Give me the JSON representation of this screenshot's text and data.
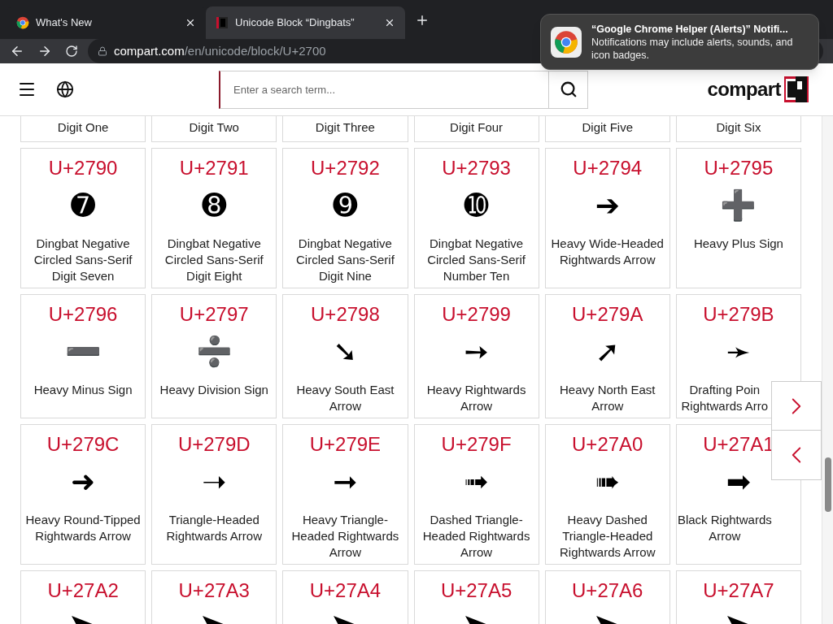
{
  "browser": {
    "tabs": [
      {
        "title": "What's New",
        "selected": false
      },
      {
        "title": "Unicode Block “Dingbats”",
        "selected": true
      }
    ],
    "url_host": "compart.com",
    "url_path": "/en/unicode/block/U+2700"
  },
  "notification": {
    "title": "“Google Chrome Helper (Alerts)” Notifi...",
    "body": "Notifications may include alerts, sounds, and icon badges."
  },
  "header": {
    "search_placeholder": "Enter a search term...",
    "logo": "compart"
  },
  "top_row": [
    {
      "name": [
        "Digit One"
      ]
    },
    {
      "name": [
        "Digit Two"
      ]
    },
    {
      "name": [
        "Digit Three"
      ]
    },
    {
      "name": [
        "Digit Four"
      ]
    },
    {
      "name": [
        "Digit Five"
      ]
    },
    {
      "name": [
        "Digit Six"
      ]
    }
  ],
  "rows": [
    [
      {
        "code": "U+2790",
        "glyph": "➐",
        "name": [
          "Dingbat Negative",
          "Circled Sans-Serif",
          "Digit Seven"
        ]
      },
      {
        "code": "U+2791",
        "glyph": "➑",
        "name": [
          "Dingbat Negative",
          "Circled Sans-Serif",
          "Digit Eight"
        ]
      },
      {
        "code": "U+2792",
        "glyph": "➒",
        "name": [
          "Dingbat Negative",
          "Circled Sans-Serif",
          "Digit Nine"
        ]
      },
      {
        "code": "U+2793",
        "glyph": "➓",
        "name": [
          "Dingbat Negative",
          "Circled Sans-Serif",
          "Number Ten"
        ]
      },
      {
        "code": "U+2794",
        "glyph": "➔",
        "name": [
          "Heavy Wide-Headed",
          "Rightwards Arrow"
        ]
      },
      {
        "code": "U+2795",
        "glyph": "➕",
        "name": [
          "Heavy Plus Sign"
        ]
      }
    ],
    [
      {
        "code": "U+2796",
        "glyph": "➖",
        "name": [
          "Heavy Minus Sign"
        ]
      },
      {
        "code": "U+2797",
        "glyph": "➗",
        "name": [
          "Heavy Division Sign"
        ]
      },
      {
        "code": "U+2798",
        "glyph": "➘",
        "name": [
          "Heavy South East",
          "Arrow"
        ]
      },
      {
        "code": "U+2799",
        "glyph": "➙",
        "name": [
          "Heavy Rightwards",
          "Arrow"
        ]
      },
      {
        "code": "U+279A",
        "glyph": "➚",
        "name": [
          "Heavy North East",
          "Arrow"
        ]
      },
      {
        "code": "U+279B",
        "glyph": "➛",
        "name": [
          "Drafting Poin",
          "Rightwards Arro"
        ],
        "clipped": true
      }
    ],
    [
      {
        "code": "U+279C",
        "glyph": "➜",
        "name": [
          "Heavy Round-Tipped",
          "Rightwards Arrow"
        ]
      },
      {
        "code": "U+279D",
        "glyph": "➝",
        "name": [
          "Triangle-Headed",
          "Rightwards Arrow"
        ]
      },
      {
        "code": "U+279E",
        "glyph": "➞",
        "name": [
          "Heavy Triangle-",
          "Headed Rightwards",
          "Arrow"
        ]
      },
      {
        "code": "U+279F",
        "glyph": "➟",
        "name": [
          "Dashed Triangle-",
          "Headed Rightwards",
          "Arrow"
        ]
      },
      {
        "code": "U+27A0",
        "glyph": "➠",
        "name": [
          "Heavy Dashed",
          "Triangle-Headed",
          "Rightwards Arrow"
        ]
      },
      {
        "code": "U+27A1",
        "glyph": "➡",
        "name": [
          "Black Rightwards",
          "Arrow"
        ],
        "clipped": true
      }
    ],
    [
      {
        "code": "U+27A2"
      },
      {
        "code": "U+27A3"
      },
      {
        "code": "U+27A4"
      },
      {
        "code": "U+27A5"
      },
      {
        "code": "U+27A6"
      },
      {
        "code": "U+27A7"
      }
    ]
  ]
}
